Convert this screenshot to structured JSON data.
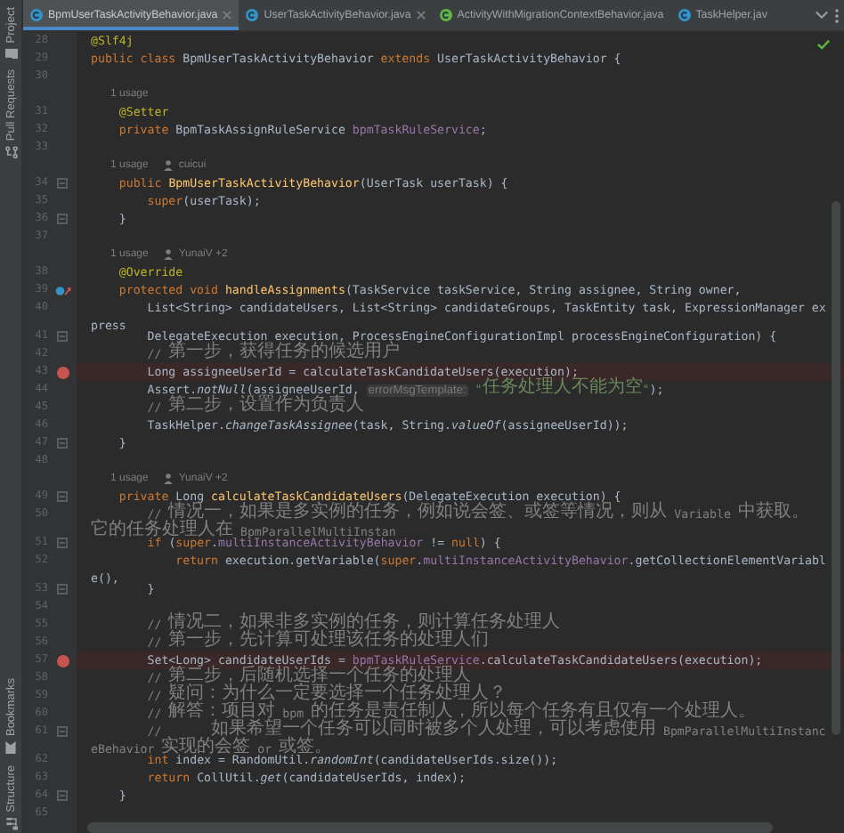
{
  "tool_strip": {
    "top": [
      {
        "label": "Project",
        "kind": "folder"
      },
      {
        "label": "Pull Requests",
        "kind": "pull"
      }
    ],
    "bottom": [
      {
        "label": "Bookmarks",
        "kind": "bookmark"
      },
      {
        "label": "Structure",
        "kind": "structure"
      }
    ]
  },
  "tabs": [
    {
      "label": "BpmUserTaskActivityBehavior.java",
      "kind": "class",
      "selected": true,
      "closable": true
    },
    {
      "label": "UserTaskActivityBehavior.java",
      "kind": "class",
      "selected": false,
      "closable": true
    },
    {
      "label": "ActivityWithMigrationContextBehavior.java",
      "kind": "interface",
      "selected": false,
      "closable": false
    },
    {
      "label": "TaskHelper.jav",
      "kind": "class",
      "selected": false,
      "closable": false
    }
  ],
  "editor": {
    "lines": [
      {
        "kind": "code",
        "number": "28",
        "breakpoint": false,
        "foldable": false,
        "override": false,
        "tokens": [
          {
            "kind": "annotation",
            "text": "@Slf4j"
          }
        ]
      },
      {
        "kind": "code",
        "number": "29",
        "breakpoint": false,
        "foldable": false,
        "override": false,
        "tokens": [
          {
            "kind": "keyword",
            "text": "public class "
          },
          {
            "kind": "plain",
            "text": "BpmUserTaskActivityBehavior "
          },
          {
            "kind": "keyword",
            "text": "extends "
          },
          {
            "kind": "plain",
            "text": "UserTaskActivityBehavior {"
          }
        ]
      },
      {
        "kind": "code",
        "number": "30",
        "breakpoint": false,
        "foldable": false,
        "override": false
      },
      {
        "kind": "usage",
        "usage": "1 usage"
      },
      {
        "kind": "code",
        "number": "31",
        "breakpoint": false,
        "foldable": false,
        "override": false,
        "tokens": [
          {
            "kind": "annotation",
            "text": "    @Setter"
          }
        ]
      },
      {
        "kind": "code",
        "number": "32",
        "breakpoint": false,
        "foldable": false,
        "override": false,
        "tokens": [
          {
            "kind": "keyword",
            "text": "    private "
          },
          {
            "kind": "plain",
            "text": "BpmTaskAssignRuleService "
          },
          {
            "kind": "field",
            "text": "bpmTaskRuleService"
          },
          {
            "kind": "plain",
            "text": ";"
          }
        ]
      },
      {
        "kind": "code",
        "number": "33",
        "breakpoint": false,
        "foldable": false,
        "override": false
      },
      {
        "kind": "usage",
        "usage": "1 usage",
        "author": "cuicui"
      },
      {
        "kind": "code",
        "number": "34",
        "breakpoint": false,
        "foldable": true,
        "override": false,
        "tokens": [
          {
            "kind": "keyword",
            "text": "    public "
          },
          {
            "kind": "method",
            "text": "BpmUserTaskActivityBehavior"
          },
          {
            "kind": "plain",
            "text": "(UserTask userTask) {"
          }
        ]
      },
      {
        "kind": "code",
        "number": "35",
        "breakpoint": false,
        "foldable": false,
        "override": false,
        "tokens": [
          {
            "kind": "keyword",
            "text": "        super"
          },
          {
            "kind": "plain",
            "text": "(userTask);"
          }
        ]
      },
      {
        "kind": "code",
        "number": "36",
        "breakpoint": false,
        "foldable": true,
        "override": false,
        "tokens": [
          {
            "kind": "plain",
            "text": "    }"
          }
        ]
      },
      {
        "kind": "code",
        "number": "37",
        "breakpoint": false,
        "foldable": false,
        "override": false
      },
      {
        "kind": "usage",
        "usage": "1 usage",
        "author": "YunaiV +2"
      },
      {
        "kind": "code",
        "number": "38",
        "breakpoint": false,
        "foldable": false,
        "override": false,
        "tokens": [
          {
            "kind": "annotation",
            "text": "    @Override"
          }
        ]
      },
      {
        "kind": "code",
        "number": "39",
        "breakpoint": false,
        "foldable": false,
        "override": true,
        "tokens": [
          {
            "kind": "keyword",
            "text": "    protected void "
          },
          {
            "kind": "method",
            "text": "handleAssignments"
          },
          {
            "kind": "plain",
            "text": "(TaskService taskService, String assignee, String owner,"
          }
        ]
      },
      {
        "kind": "code",
        "number": "40",
        "breakpoint": false,
        "foldable": false,
        "override": false,
        "tokens": [
          {
            "kind": "plain",
            "text": "        List<String> candidateUsers, List<String> candidateGroups, TaskEntity task, ExpressionManager express"
          }
        ]
      },
      {
        "kind": "code",
        "number": "41",
        "breakpoint": false,
        "foldable": true,
        "override": false,
        "tokens": [
          {
            "kind": "plain",
            "text": "        DelegateExecution execution, ProcessEngineConfigurationImpl processEngineConfiguration) {"
          }
        ]
      },
      {
        "kind": "code",
        "number": "42",
        "breakpoint": false,
        "foldable": false,
        "override": false,
        "tokens": [
          {
            "kind": "comment",
            "text": "        // 第一步，获得任务的候选用户"
          }
        ]
      },
      {
        "kind": "code",
        "number": "43",
        "breakpoint": true,
        "foldable": false,
        "override": false,
        "tokens": [
          {
            "kind": "plain",
            "text": "        Long assigneeUserId = calculateTaskCandidateUsers(execution);"
          }
        ]
      },
      {
        "kind": "code",
        "number": "44",
        "breakpoint": false,
        "foldable": false,
        "override": false,
        "tokens": [
          {
            "kind": "plain",
            "text": "        Assert."
          },
          {
            "kind": "static",
            "text": "notNull"
          },
          {
            "kind": "plain",
            "text": "(assigneeUserId, "
          },
          {
            "kind": "hint",
            "text": "errorMsgTemplate:"
          },
          {
            "kind": "string",
            "text": " \"任务处理人不能为空\""
          },
          {
            "kind": "plain",
            "text": ");"
          }
        ]
      },
      {
        "kind": "code",
        "number": "45",
        "breakpoint": false,
        "foldable": false,
        "override": false,
        "tokens": [
          {
            "kind": "comment",
            "text": "        // 第二步，设置作为负责人"
          }
        ]
      },
      {
        "kind": "code",
        "number": "46",
        "breakpoint": false,
        "foldable": false,
        "override": false,
        "tokens": [
          {
            "kind": "plain",
            "text": "        TaskHelper."
          },
          {
            "kind": "static",
            "text": "changeTaskAssignee"
          },
          {
            "kind": "plain",
            "text": "(task, String."
          },
          {
            "kind": "static",
            "text": "valueOf"
          },
          {
            "kind": "plain",
            "text": "(assigneeUserId));"
          }
        ]
      },
      {
        "kind": "code",
        "number": "47",
        "breakpoint": false,
        "foldable": true,
        "override": false,
        "tokens": [
          {
            "kind": "plain",
            "text": "    }"
          }
        ]
      },
      {
        "kind": "code",
        "number": "48",
        "breakpoint": false,
        "foldable": false,
        "override": false
      },
      {
        "kind": "usage",
        "usage": "1 usage",
        "author": "YunaiV +2"
      },
      {
        "kind": "code",
        "number": "49",
        "breakpoint": false,
        "foldable": true,
        "override": false,
        "tokens": [
          {
            "kind": "keyword",
            "text": "    private "
          },
          {
            "kind": "plain",
            "text": "Long "
          },
          {
            "kind": "method",
            "text": "calculateTaskCandidateUsers"
          },
          {
            "kind": "plain",
            "text": "(DelegateExecution execution) {"
          }
        ]
      },
      {
        "kind": "code",
        "number": "50",
        "breakpoint": false,
        "foldable": false,
        "override": false,
        "tokens": [
          {
            "kind": "comment",
            "text": "        // 情况一，如果是多实例的任务，例如说会签、或签等情况，则从 Variable 中获取。它的任务处理人在 BpmParallelMultiInstan"
          }
        ]
      },
      {
        "kind": "code",
        "number": "51",
        "breakpoint": false,
        "foldable": true,
        "override": false,
        "tokens": [
          {
            "kind": "keyword",
            "text": "        if "
          },
          {
            "kind": "plain",
            "text": "("
          },
          {
            "kind": "keyword",
            "text": "super"
          },
          {
            "kind": "plain",
            "text": "."
          },
          {
            "kind": "field",
            "text": "multiInstanceActivityBehavior"
          },
          {
            "kind": "plain",
            "text": " != "
          },
          {
            "kind": "keyword",
            "text": "null"
          },
          {
            "kind": "plain",
            "text": ") {"
          }
        ]
      },
      {
        "kind": "code",
        "number": "52",
        "breakpoint": false,
        "foldable": false,
        "override": false,
        "tokens": [
          {
            "kind": "keyword",
            "text": "            return "
          },
          {
            "kind": "plain",
            "text": "execution.getVariable("
          },
          {
            "kind": "keyword",
            "text": "super"
          },
          {
            "kind": "plain",
            "text": "."
          },
          {
            "kind": "field",
            "text": "multiInstanceActivityBehavior"
          },
          {
            "kind": "plain",
            "text": ".getCollectionElementVariable(),"
          }
        ]
      },
      {
        "kind": "code",
        "number": "53",
        "breakpoint": false,
        "foldable": true,
        "override": false,
        "tokens": [
          {
            "kind": "plain",
            "text": "        }"
          }
        ]
      },
      {
        "kind": "code",
        "number": "54",
        "breakpoint": false,
        "foldable": false,
        "override": false
      },
      {
        "kind": "code",
        "number": "55",
        "breakpoint": false,
        "foldable": false,
        "override": false,
        "tokens": [
          {
            "kind": "comment",
            "text": "        // 情况二，如果非多实例的任务，则计算任务处理人"
          }
        ]
      },
      {
        "kind": "code",
        "number": "56",
        "breakpoint": false,
        "foldable": false,
        "override": false,
        "tokens": [
          {
            "kind": "comment",
            "text": "        // 第一步，先计算可处理该任务的处理人们"
          }
        ]
      },
      {
        "kind": "code",
        "number": "57",
        "breakpoint": true,
        "foldable": false,
        "override": false,
        "tokens": [
          {
            "kind": "plain",
            "text": "        Set<Long> candidateUserIds = "
          },
          {
            "kind": "field",
            "text": "bpmTaskRuleService"
          },
          {
            "kind": "plain",
            "text": ".calculateTaskCandidateUsers(execution);"
          }
        ]
      },
      {
        "kind": "code",
        "number": "58",
        "breakpoint": false,
        "foldable": false,
        "override": false,
        "tokens": [
          {
            "kind": "comment",
            "text": "        // 第二步，后随机选择一个任务的处理人"
          }
        ]
      },
      {
        "kind": "code",
        "number": "59",
        "breakpoint": false,
        "foldable": false,
        "override": false,
        "tokens": [
          {
            "kind": "comment",
            "text": "        // 疑问：为什么一定要选择一个任务处理人？"
          }
        ]
      },
      {
        "kind": "code",
        "number": "60",
        "breakpoint": false,
        "foldable": false,
        "override": false,
        "tokens": [
          {
            "kind": "comment",
            "text": "        // 解答：项目对 bpm 的任务是责任制人，所以每个任务有且仅有一个处理人。"
          }
        ]
      },
      {
        "kind": "code",
        "number": "61",
        "breakpoint": false,
        "foldable": true,
        "override": false,
        "tokens": [
          {
            "kind": "comment",
            "text": "        //       如果希望一个任务可以同时被多个人处理，可以考虑使用 BpmParallelMultiInstanceBehavior 实现的会签 or 或签。"
          }
        ]
      },
      {
        "kind": "code",
        "number": "62",
        "breakpoint": false,
        "foldable": false,
        "override": false,
        "tokens": [
          {
            "kind": "keyword",
            "text": "        int "
          },
          {
            "kind": "plain",
            "text": "index = RandomUtil."
          },
          {
            "kind": "static",
            "text": "randomInt"
          },
          {
            "kind": "plain",
            "text": "(candidateUserIds.size());"
          }
        ]
      },
      {
        "kind": "code",
        "number": "63",
        "breakpoint": false,
        "foldable": false,
        "override": false,
        "tokens": [
          {
            "kind": "keyword",
            "text": "        return "
          },
          {
            "kind": "plain",
            "text": "CollUtil."
          },
          {
            "kind": "static",
            "text": "get"
          },
          {
            "kind": "plain",
            "text": "(candidateUserIds, index);"
          }
        ]
      },
      {
        "kind": "code",
        "number": "64",
        "breakpoint": false,
        "foldable": true,
        "override": false,
        "tokens": [
          {
            "kind": "plain",
            "text": "    }"
          }
        ]
      },
      {
        "kind": "code",
        "number": "65",
        "breakpoint": false,
        "foldable": false,
        "override": false
      }
    ]
  }
}
